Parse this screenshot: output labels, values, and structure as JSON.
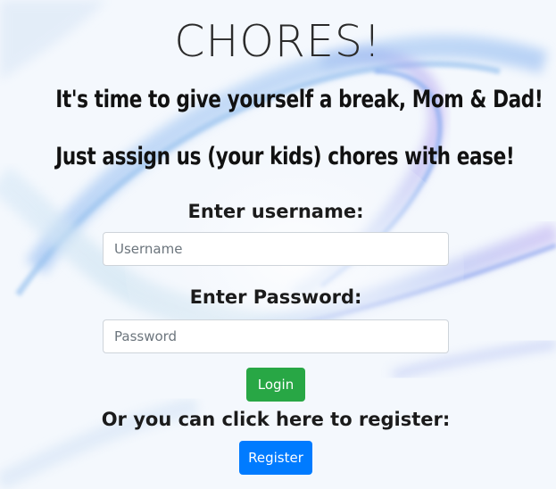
{
  "header": {
    "title": "CHORES!",
    "tagline_1": "It's time to give yourself a break, Mom & Dad!",
    "tagline_2": "Just assign us (your kids) chores with ease!"
  },
  "login_form": {
    "username_label": "Enter username:",
    "username_placeholder": "Username",
    "username_value": "",
    "password_label": "Enter Password:",
    "password_placeholder": "Password",
    "password_value": "",
    "login_label": "Login"
  },
  "register": {
    "prompt": "Or you can click here to register:",
    "button_label": "Register"
  },
  "colors": {
    "login_button": "#28a745",
    "register_button": "#007bff",
    "background": "#f6f9fe"
  }
}
